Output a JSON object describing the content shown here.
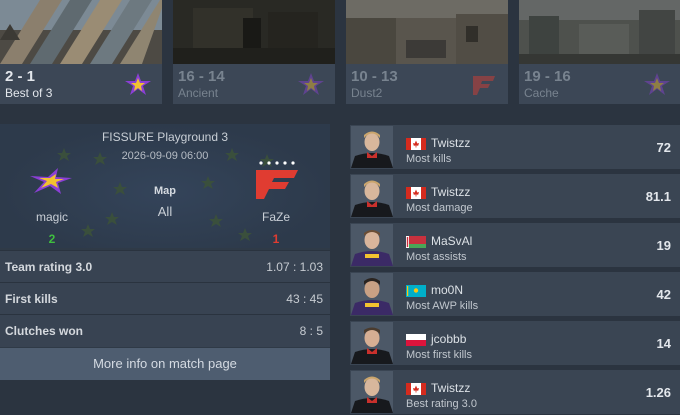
{
  "maps": [
    {
      "score": "2 - 1",
      "name": "Best of 3",
      "logo": "magic-logo"
    },
    {
      "score": "16 - 14",
      "name": "Ancient",
      "logo": "magic-logo"
    },
    {
      "score": "10 - 13",
      "name": "Dust2",
      "logo": "faze-logo"
    },
    {
      "score": "19 - 16",
      "name": "Cache",
      "logo": "magic-logo"
    }
  ],
  "match": {
    "event": "FISSURE Playground 3",
    "date": "2026-09-09 06:00",
    "map_label": "Map",
    "map_value": "All",
    "team1": {
      "name": "magic",
      "score": "2",
      "score_color": "#3fbf3f",
      "logo": "magic-logo"
    },
    "team2": {
      "name": "FaZe",
      "score": "1",
      "score_color": "#e03c31",
      "logo": "faze-logo"
    },
    "stats": [
      {
        "label": "Team rating 3.0",
        "value": "1.07 : 1.03"
      },
      {
        "label": "First kills",
        "value": "43 : 45"
      },
      {
        "label": "Clutches won",
        "value": "8 : 5"
      }
    ],
    "more_info": "More info on match page"
  },
  "players": [
    {
      "name": "Twistzz",
      "stat": "Most kills",
      "value": "72",
      "flag": "flag-canada"
    },
    {
      "name": "Twistzz",
      "stat": "Most damage",
      "value": "81.1",
      "flag": "flag-canada"
    },
    {
      "name": "MaSvAl",
      "stat": "Most assists",
      "value": "19",
      "flag": "flag-belarus"
    },
    {
      "name": "mo0N",
      "stat": "Most AWP kills",
      "value": "42",
      "flag": "flag-kazakhstan"
    },
    {
      "name": "jcobbb",
      "stat": "Most first kills",
      "value": "14",
      "flag": "flag-poland"
    },
    {
      "name": "Twistzz",
      "stat": "Best rating 3.0",
      "value": "1.26",
      "flag": "flag-canada"
    }
  ]
}
